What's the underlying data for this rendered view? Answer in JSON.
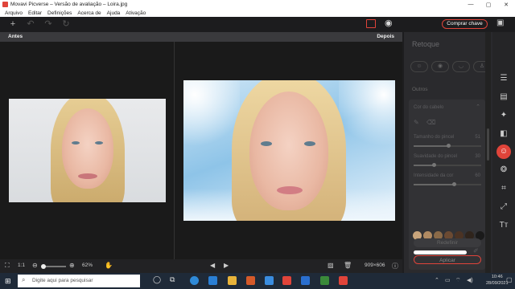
{
  "window": {
    "title": "Movavi Picverse – Versão de avaliação – Loira.jpg",
    "minimize": "—",
    "maximize": "▢",
    "close": "✕"
  },
  "menu": [
    "Arquivo",
    "Editar",
    "Definições",
    "Acerca de",
    "Ajuda",
    "Ativação"
  ],
  "toolbar": {
    "buy_label": "Comprar chave"
  },
  "compare": {
    "before_label": "Antes",
    "after_label": "Depois"
  },
  "panel": {
    "title": "Retoque",
    "section": "Outros",
    "subsection": "Cor do cabelo",
    "sliders": [
      {
        "label": "Tamanho do pincel",
        "value": "51",
        "level": 0.51
      },
      {
        "label": "Suavidade do pincel",
        "value": "30",
        "level": 0.3
      },
      {
        "label": "Intensidade da cor",
        "value": "60",
        "level": 0.6
      }
    ],
    "swatch_colors": [
      "#c9a57c",
      "#b08a62",
      "#8a6a48",
      "#6b4a32",
      "#4b3324",
      "#2f241c",
      "#1a1a1a"
    ],
    "reset_label": "Redefinir",
    "apply_label": "Aplicar"
  },
  "bottom": {
    "ratio_label": "1:1",
    "zoom_percent": "62%",
    "zoom_level": 0.62,
    "image_size": "909×606"
  },
  "taskbar": {
    "search_placeholder": "Digite aqui para pesquisar",
    "time": "10:46",
    "date": "28/09/2021"
  },
  "colors": {
    "accent": "#e0443a",
    "panel_bg": "#2a2a2d",
    "canvas_bg": "#1a1a1a"
  }
}
